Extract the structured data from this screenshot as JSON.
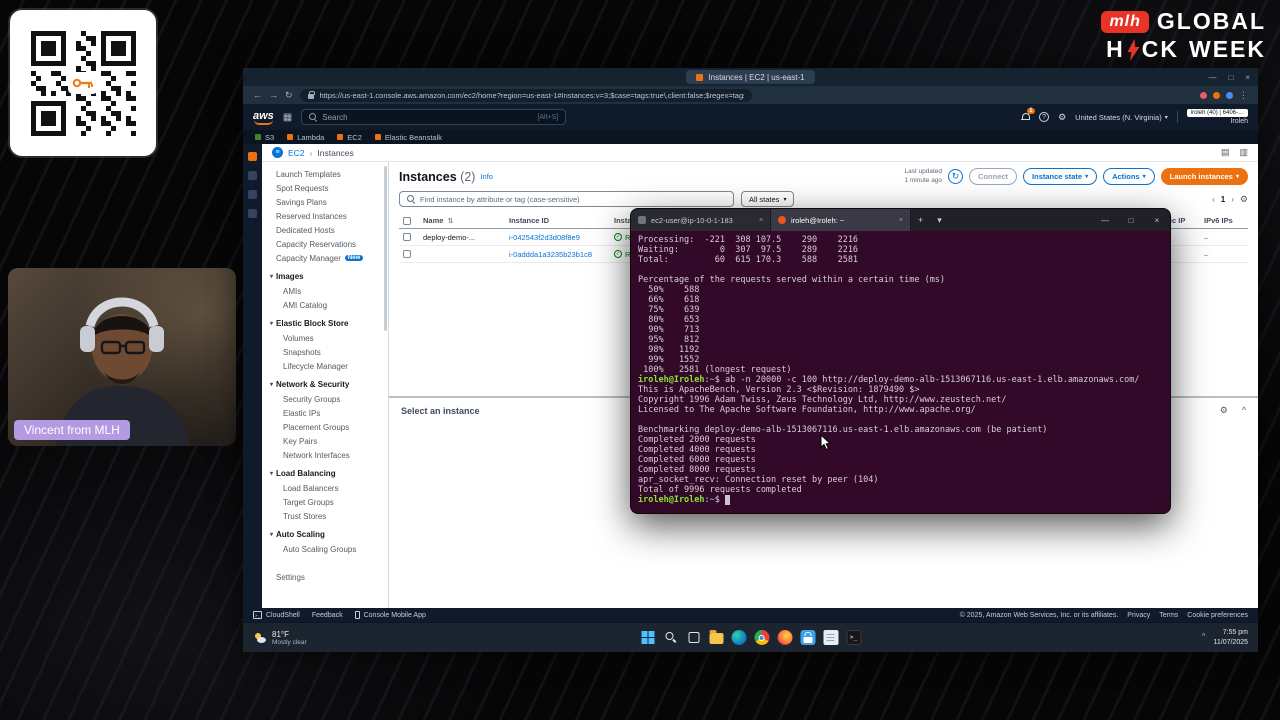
{
  "colors": {
    "aws_orange": "#ec7211",
    "link_blue": "#0972d3",
    "success_green": "#037f0c",
    "mlh_red": "#e73427",
    "terminal_bg": "#33092a",
    "terminal_green": "#8ae234",
    "terminal_blue": "#729fcf",
    "webcam_badge_purple": "#b49ae2"
  },
  "overlay": {
    "brand": {
      "mlh": "mlh",
      "global": "GLOBAL",
      "hack_h": "H",
      "hack_ck": "CK",
      "week": "WEEK"
    },
    "webcam_label": "Vincent from MLH"
  },
  "browser": {
    "tab_title": "Instances | EC2 | us-east-1",
    "url": "https://us-east-1.console.aws.amazon.com/ec2/home?region=us-east-1#Instances:v=3;$case=tags:true\\,client:false;$regex=tags:false\\,client:false"
  },
  "aws_nav": {
    "logo": "aws",
    "search_placeholder": "Search",
    "search_shortcut": "[Alt+S]",
    "bell_badge": "1",
    "region": "United States (N. Virginia)",
    "account_popup": "iroleh (40) | 6406-…",
    "user": "Iroleh"
  },
  "bookmarks": [
    {
      "label": "S3",
      "color": "#3f8624"
    },
    {
      "label": "Lambda",
      "color": "#ec7211"
    },
    {
      "label": "EC2",
      "color": "#ec7211"
    },
    {
      "label": "Elastic Beanstalk",
      "color": "#ec7211"
    }
  ],
  "console": {
    "breadcrumb": {
      "root": "EC2",
      "sep": "›",
      "current": "Instances"
    },
    "sidebar": {
      "sections": [
        {
          "items": [
            {
              "label": "Launch Templates"
            },
            {
              "label": "Spot Requests"
            },
            {
              "label": "Savings Plans"
            },
            {
              "label": "Reserved Instances"
            },
            {
              "label": "Dedicated Hosts"
            },
            {
              "label": "Capacity Reservations"
            },
            {
              "label": "Capacity Manager",
              "badge": "New"
            }
          ]
        },
        {
          "header": "Images",
          "items": [
            {
              "label": "AMIs"
            },
            {
              "label": "AMI Catalog"
            }
          ]
        },
        {
          "header": "Elastic Block Store",
          "items": [
            {
              "label": "Volumes"
            },
            {
              "label": "Snapshots"
            },
            {
              "label": "Lifecycle Manager"
            }
          ]
        },
        {
          "header": "Network & Security",
          "items": [
            {
              "label": "Security Groups"
            },
            {
              "label": "Elastic IPs"
            },
            {
              "label": "Placement Groups"
            },
            {
              "label": "Key Pairs"
            },
            {
              "label": "Network Interfaces"
            }
          ]
        },
        {
          "header": "Load Balancing",
          "items": [
            {
              "label": "Load Balancers"
            },
            {
              "label": "Target Groups"
            },
            {
              "label": "Trust Stores"
            }
          ]
        },
        {
          "header": "Auto Scaling",
          "items": [
            {
              "label": "Auto Scaling Groups"
            }
          ]
        },
        {
          "gap": true,
          "items": [
            {
              "label": "Settings"
            }
          ]
        }
      ]
    },
    "instances": {
      "title": "Instances",
      "count": "(2)",
      "info_link": "Info",
      "last_updated_1": "Last updated",
      "last_updated_2": "1 minute ago",
      "connect_button": "Connect",
      "instance_state_button": "Instance state",
      "actions_button": "Actions",
      "launch_button": "Launch instances",
      "filter_placeholder": "Find instance by attribute or tag (case-sensitive)",
      "states_filter": "All states",
      "page_number": "1",
      "table": {
        "headers": [
          "Name",
          "Instance ID",
          "Instance state",
          "Elastic IP",
          "IPv6 IPs"
        ],
        "rows": [
          {
            "name": "deploy-demo-...",
            "id": "i-042543f2d3d08f8e9",
            "state": "Running",
            "elastic_ip": "–",
            "ipv6": "–"
          },
          {
            "name": "",
            "id": "i-0addda1a3235b23b1c8",
            "state": "Running",
            "elastic_ip": "–",
            "ipv6": "–"
          }
        ]
      },
      "details_title": "Select an instance"
    },
    "footer": {
      "cloudshell": "CloudShell",
      "feedback": "Feedback",
      "mobile_app": "Console Mobile App",
      "copyright": "© 2025, Amazon Web Services, Inc. or its affiliates.",
      "privacy": "Privacy",
      "terms": "Terms",
      "cookie": "Cookie preferences"
    }
  },
  "taskbar": {
    "temperature": "81°F",
    "condition": "Mostly clear",
    "time": "7:55 pm",
    "date": "11/07/2025",
    "icons": [
      "start",
      "search",
      "task-view",
      "file-explorer",
      "edge",
      "chrome",
      "firefox",
      "store",
      "notepad",
      "terminal"
    ]
  },
  "terminal": {
    "tabs": [
      {
        "title": "ec2-user@ip-10-0-1-183",
        "icon": "ssh",
        "active": false
      },
      {
        "title": "iroleh@Iroleh: ~",
        "icon": "ubuntu",
        "active": true
      }
    ],
    "lines": [
      [
        [
          "f",
          "Processing:  -221  308 107.5    290    2216"
        ]
      ],
      [
        [
          "f",
          "Waiting:        0  307  97.5    289    2216"
        ]
      ],
      [
        [
          "f",
          "Total:         60  615 170.3    588    2581"
        ]
      ],
      [
        [
          "f",
          ""
        ]
      ],
      [
        [
          "f",
          "Percentage of the requests served within a certain time (ms)"
        ]
      ],
      [
        [
          "f",
          "  50%    588"
        ]
      ],
      [
        [
          "f",
          "  66%    618"
        ]
      ],
      [
        [
          "f",
          "  75%    639"
        ]
      ],
      [
        [
          "f",
          "  80%    653"
        ]
      ],
      [
        [
          "f",
          "  90%    713"
        ]
      ],
      [
        [
          "f",
          "  95%    812"
        ]
      ],
      [
        [
          "f",
          "  98%   1192"
        ]
      ],
      [
        [
          "f",
          "  99%   1552"
        ]
      ],
      [
        [
          "f",
          " 100%   2581 (longest request)"
        ]
      ],
      [
        [
          "g",
          "iroleh@Iroleh"
        ],
        [
          "f",
          ":"
        ],
        [
          "b",
          "~"
        ],
        [
          "f",
          "$ ab -n 20000 -c 100 http://deploy-demo-alb-1513067116.us-east-1.elb.amazonaws.com/"
        ]
      ],
      [
        [
          "f",
          "This is ApacheBench, Version 2.3 <$Revision: 1879490 $>"
        ]
      ],
      [
        [
          "f",
          "Copyright 1996 Adam Twiss, Zeus Technology Ltd, http://www.zeustech.net/"
        ]
      ],
      [
        [
          "f",
          "Licensed to The Apache Software Foundation, http://www.apache.org/"
        ]
      ],
      [
        [
          "f",
          ""
        ]
      ],
      [
        [
          "f",
          "Benchmarking deploy-demo-alb-1513067116.us-east-1.elb.amazonaws.com (be patient)"
        ]
      ],
      [
        [
          "f",
          "Completed 2000 requests"
        ]
      ],
      [
        [
          "f",
          "Completed 4000 requests"
        ]
      ],
      [
        [
          "f",
          "Completed 6000 requests"
        ]
      ],
      [
        [
          "f",
          "Completed 8000 requests"
        ]
      ],
      [
        [
          "f",
          "apr_socket_recv: Connection reset by peer (104)"
        ]
      ],
      [
        [
          "f",
          "Total of 9996 requests completed"
        ]
      ],
      [
        [
          "g",
          "iroleh@Iroleh"
        ],
        [
          "f",
          ":"
        ],
        [
          "b",
          "~"
        ],
        [
          "f",
          "$ "
        ],
        [
          "cur",
          " "
        ]
      ]
    ]
  }
}
